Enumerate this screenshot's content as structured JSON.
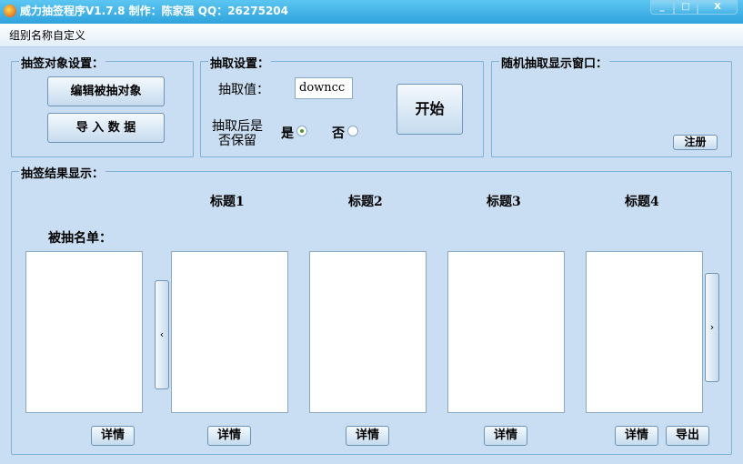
{
  "window": {
    "title": "威力抽签程序V1.7.8  制作：陈家强  QQ：26275204",
    "minimize": "_",
    "maximize": "□",
    "close": "X"
  },
  "menu": {
    "item": "组别名称自定义"
  },
  "target_settings": {
    "title": "抽签对象设置：",
    "edit_button": "编辑被抽对象",
    "import_button": "导 入 数 据"
  },
  "draw_settings": {
    "title": "抽取设置：",
    "value_label": "抽取值：",
    "value": "downcc",
    "keep_label": "抽取后是否保留",
    "yes": "是",
    "no": "否",
    "selected": "是",
    "start_button": "开始"
  },
  "random_display": {
    "title": "随机抽取显示窗口：",
    "register_button": "注册"
  },
  "results": {
    "title": "抽签结果显示：",
    "source_label": "被抽名单：",
    "headers": [
      "标题1",
      "标题2",
      "标题3",
      "标题4"
    ],
    "details_button": "详情",
    "export_button": "导出",
    "prev": "‹",
    "next": "›"
  }
}
